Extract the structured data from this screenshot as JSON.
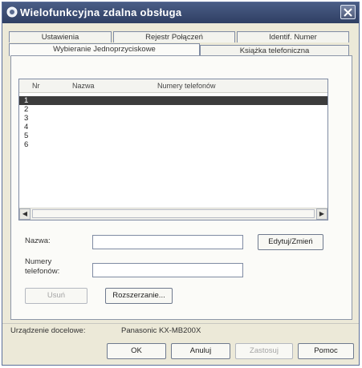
{
  "window": {
    "title": "Wielofunkcyjna zdalna obsługa"
  },
  "tabs_row1": [
    "Ustawienia",
    "Rejestr Połączeń",
    "Identif. Numer"
  ],
  "tabs_row2": [
    "Wybieranie Jednoprzyciskowe",
    "Książka telefoniczna"
  ],
  "list": {
    "columns": [
      "Nr",
      "Nazwa",
      "Numery telefonów"
    ],
    "rows": [
      {
        "nr": "1",
        "selected": true
      },
      {
        "nr": "2"
      },
      {
        "nr": "3"
      },
      {
        "nr": "4"
      },
      {
        "nr": "5"
      },
      {
        "nr": "6"
      }
    ]
  },
  "form": {
    "name_label": "Nazwa:",
    "name_value": "",
    "numbers_label_line1": "Numery",
    "numbers_label_line2": "telefonów:",
    "numbers_value": "",
    "edit_button": "Edytuj/Zmień",
    "delete_button": "Usuń",
    "expand_button": "Rozszerzanie..."
  },
  "target_device": {
    "label": "Urządzenie docelowe:",
    "value": "Panasonic KX-MB200X"
  },
  "footer": {
    "ok": "OK",
    "cancel": "Anuluj",
    "apply": "Zastosuj",
    "help": "Pomoc"
  }
}
